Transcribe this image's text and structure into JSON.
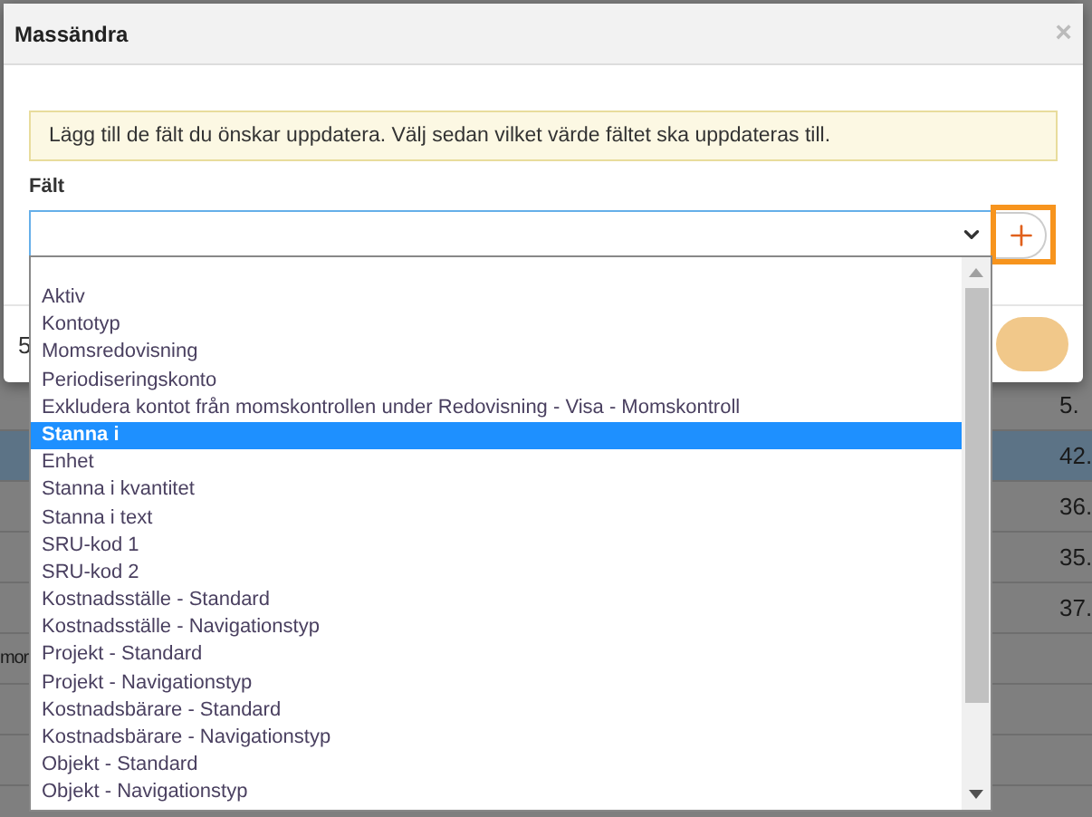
{
  "dialog": {
    "title": "Massändra",
    "close": "×",
    "notice": "Lägg till de fält du önskar uppdatera. Välj sedan vilket värde fältet ska uppdateras till.",
    "field_label": "Fält",
    "footer_text": "5",
    "save_disabled": true
  },
  "dropdown": {
    "options": [
      {
        "label": "Aktiv",
        "selected": false
      },
      {
        "label": "Kontotyp",
        "selected": false
      },
      {
        "label": "Momsredovisning",
        "selected": false
      },
      {
        "label": "Periodiseringskonto",
        "selected": false
      },
      {
        "label": "Exkludera kontot från momskontrollen under Redovisning - Visa - Momskontroll",
        "selected": false
      },
      {
        "label": "Stanna i",
        "selected": true
      },
      {
        "label": "Enhet",
        "selected": false
      },
      {
        "label": "Stanna i kvantitet",
        "selected": false
      },
      {
        "label": "Stanna i text",
        "selected": false
      },
      {
        "label": "SRU-kod 1",
        "selected": false
      },
      {
        "label": "SRU-kod 2",
        "selected": false
      },
      {
        "label": "Kostnadsställe - Standard",
        "selected": false
      },
      {
        "label": "Kostnadsställe - Navigationstyp",
        "selected": false
      },
      {
        "label": "Projekt - Standard",
        "selected": false
      },
      {
        "label": "Projekt - Navigationstyp",
        "selected": false
      },
      {
        "label": "Kostnadsbärare - Standard",
        "selected": false
      },
      {
        "label": "Kostnadsbärare - Navigationstyp",
        "selected": false
      },
      {
        "label": "Objekt - Standard",
        "selected": false
      },
      {
        "label": "Objekt - Navigationstyp",
        "selected": false
      }
    ]
  },
  "background_rows": [
    {
      "column_2": "5.",
      "selected": false
    },
    {
      "column_2": "42.",
      "selected": true
    },
    {
      "column_2": "36.",
      "selected": false
    },
    {
      "column_2": "35.",
      "selected": false
    },
    {
      "column_2": "37.",
      "selected": false
    },
    {
      "column_1": "mor",
      "selected": false
    },
    {
      "selected": false
    },
    {
      "selected": false
    }
  ]
}
